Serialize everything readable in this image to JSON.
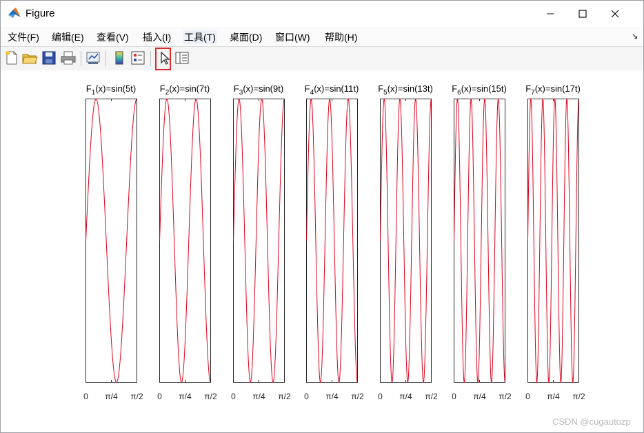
{
  "window": {
    "title": "Figure"
  },
  "menu": [
    "文件(F)",
    "编辑(E)",
    "查看(V)",
    "插入(I)",
    "工具(T)",
    "桌面(D)",
    "窗口(W)",
    "帮助(H)"
  ],
  "toolbar": {
    "buttons": [
      "new-figure",
      "open-file",
      "save",
      "print",
      "link-plot",
      "insert-colorbar",
      "insert-legend",
      "edit-plot",
      "property-inspector"
    ],
    "selected": "edit-plot"
  },
  "colors": {
    "curve": "#e0001b",
    "highlight": "#e0292b"
  },
  "chart_data": {
    "type": "line",
    "subplots": [
      {
        "title_main": "F",
        "title_sub": "1",
        "title_rest": "(x)=sin(5t)",
        "frequency": 5
      },
      {
        "title_main": "F",
        "title_sub": "2",
        "title_rest": "(x)=sin(7t)",
        "frequency": 7
      },
      {
        "title_main": "F",
        "title_sub": "3",
        "title_rest": "(x)=sin(9t)",
        "frequency": 9
      },
      {
        "title_main": "F",
        "title_sub": "4",
        "title_rest": "(x)=sin(11t)",
        "frequency": 11
      },
      {
        "title_main": "F",
        "title_sub": "5",
        "title_rest": "(x)=sin(13t)",
        "frequency": 13
      },
      {
        "title_main": "F",
        "title_sub": "6",
        "title_rest": "(x)=sin(15t)",
        "frequency": 15
      },
      {
        "title_main": "F",
        "title_sub": "7",
        "title_rest": "(x)=sin(17t)",
        "frequency": 17
      }
    ],
    "xticks": [
      "0",
      "π/4",
      "π/2"
    ],
    "xlim": [
      0,
      1.5708
    ],
    "ylim": [
      -1,
      1
    ],
    "grid": false
  },
  "watermark": "CSDN @cugautozp"
}
